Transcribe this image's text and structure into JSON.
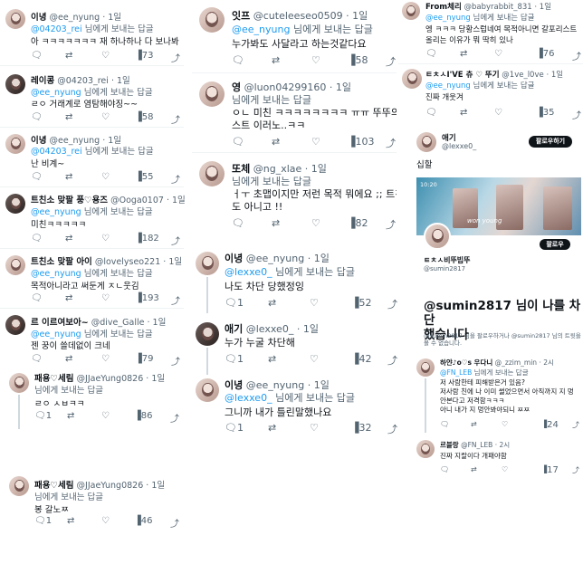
{
  "reply_to_label": "님에게 보내는 답글",
  "col1": [
    {
      "name": "이녕",
      "handle": "@ee_nyung",
      "time": "· 1일",
      "reply_to": "@04203_rei",
      "text": "아 ㅋㅋㅋㅋㅋㅋㅋ 재 하나하나 다 보나봐",
      "views": "73"
    },
    {
      "name": "레이콩",
      "handle": "@04203_rei",
      "time": "· 1일",
      "reply_to": "@ee_nyung",
      "text": "ㄹㅇ 거래계로 염탐해야징~~",
      "views": "58"
    },
    {
      "name": "이녕",
      "handle": "@ee_nyung",
      "time": "· 1일",
      "reply_to": "@04203_rei",
      "text": "난 비계~",
      "views": "55"
    },
    {
      "name": "트친소 맞팔 풍♡용즈",
      "handle": "@Ooga0107",
      "time": "· 1일",
      "reply_to": "@ee_nyung",
      "text": "미친ㅋㅋㅋㅋㅋ",
      "views": "182"
    },
    {
      "name": "트친소 맞팔 아이",
      "handle": "@lovelyseo221",
      "time": "· 1일",
      "reply_to": "@ee_nyung",
      "text": "목적아니라고 써둔게 ㅈㄴ웃김",
      "views": "193"
    },
    {
      "name": "르 이르여보아~",
      "handle": "@dive_Galle",
      "time": "· 1일",
      "reply_to": "@ee_nyung",
      "text": "젠 꿍이 쓸데없이 크네",
      "views": "79"
    },
    {
      "name": "패용♡세림",
      "handle": "@JJaeYung0826",
      "time": "· 1일",
      "reply_to": "",
      "text": "ㄹㅇ ㅅㅂㅋㅋ",
      "replies": "1",
      "views": "86"
    },
    {
      "name": "패용♡세림",
      "handle": "@JJaeYung0826",
      "time": "· 1일",
      "reply_to": "",
      "text": "봉 갈노ㅉ",
      "replies": "1",
      "views": "46"
    }
  ],
  "col2": [
    {
      "name": "잇프",
      "handle": "@cuteleeseo0509",
      "time": "· 1일",
      "reply_to": "@ee_nyung",
      "text": "누가봐도 사달라고 하는것같다요",
      "views": "58"
    },
    {
      "name": "영",
      "handle": "@luon04299160",
      "time": "· 1일",
      "reply_to": "",
      "text": "ㅇㄴ 미친 ㅋㅋㅋㅋㅋㅋㅋㅋ ㅠㅠ 뚜뚜의 갈프",
      "text2": "스트 이러노..ㅋㅋ",
      "views": "103"
    },
    {
      "name": "또체",
      "handle": "@ng_xlae",
      "time": "· 1일",
      "reply_to": "",
      "text": "ㅓㅜ 초맵이지만 저런 목적 뭐에요 ;; 트친이 지갑",
      "text2": "도 아니고 !!",
      "views": "82"
    },
    {
      "name": "이녕",
      "handle": "@ee_nyung",
      "time": "· 1일",
      "reply_to": "@lexxe0_",
      "text": "나도 차단 당했정잉",
      "replies": "1",
      "views": "52"
    },
    {
      "name": "애기",
      "handle": "@lexxe0_",
      "time": "· 1일",
      "reply_to": "",
      "text": "누가 누굴 차단해",
      "replies": "1",
      "views": "42"
    },
    {
      "name": "이녕",
      "handle": "@ee_nyung",
      "time": "· 1일",
      "reply_to": "@lexxe0_",
      "text": "그니까 내가 틀린말했나요",
      "replies": "1",
      "views": "32"
    }
  ],
  "col3": {
    "tweets": [
      {
        "name": "From체리",
        "handle": "@babyrabbit_831",
        "time": "· 1일",
        "reply_to": "@ee_nyung",
        "text": "엥 ㅋㅋㅋ 당황스럽네여 목적아니면 갈포리스트",
        "text2": "올리는 이유가 뭐 딱히 있나",
        "views": "76"
      },
      {
        "name": "ㅌㅊㅅI'VE 츄 ♡ 뚜기",
        "handle": "@1ve_l0ve",
        "time": "· 1일",
        "reply_to": "@ee_nyung",
        "text": "진짜 개웃겨",
        "views": "35"
      }
    ],
    "quote_user": {
      "name": "애기",
      "handle": "@lexxe0_",
      "follow_button": "팔로우하기",
      "caption": "십할"
    },
    "profile": {
      "name": "ㅌㅊㅅ비뚜빕뚜",
      "handle": "@sumin2817",
      "follow_button": "팔로우",
      "banner_time": "10:20",
      "banner_text": "won young",
      "blocked_title": "@sumin2817 님이 나를 차단",
      "blocked_title2": "했습니다",
      "blocked_sub": "@sumin2817 님을 팔로우하거나 @sumin2817 님의 트윗을",
      "blocked_sub2": "볼 수 없습니다."
    },
    "reply1": {
      "name": "하얀♪o♡s 우다니",
      "handle": "@_zzim_min",
      "time": "· 2시",
      "reply_to": "@FN_LEB",
      "text": "저 사람한테 피해받은거 있음?",
      "text2": "저사람 친에 나 이미 썰었으면서 아직까지 지 멍",
      "text3": "안본다고 저격함ㅋㅋㅋ",
      "text4": "아니 내가 지 멍안봐야되니 ㅉㅉ",
      "views": "24"
    },
    "reply2": {
      "name": "르블랑",
      "handle": "@FN_LEB",
      "time": "· 2시",
      "text": "진짜 지랄이다 개패야함",
      "views": "17"
    }
  }
}
